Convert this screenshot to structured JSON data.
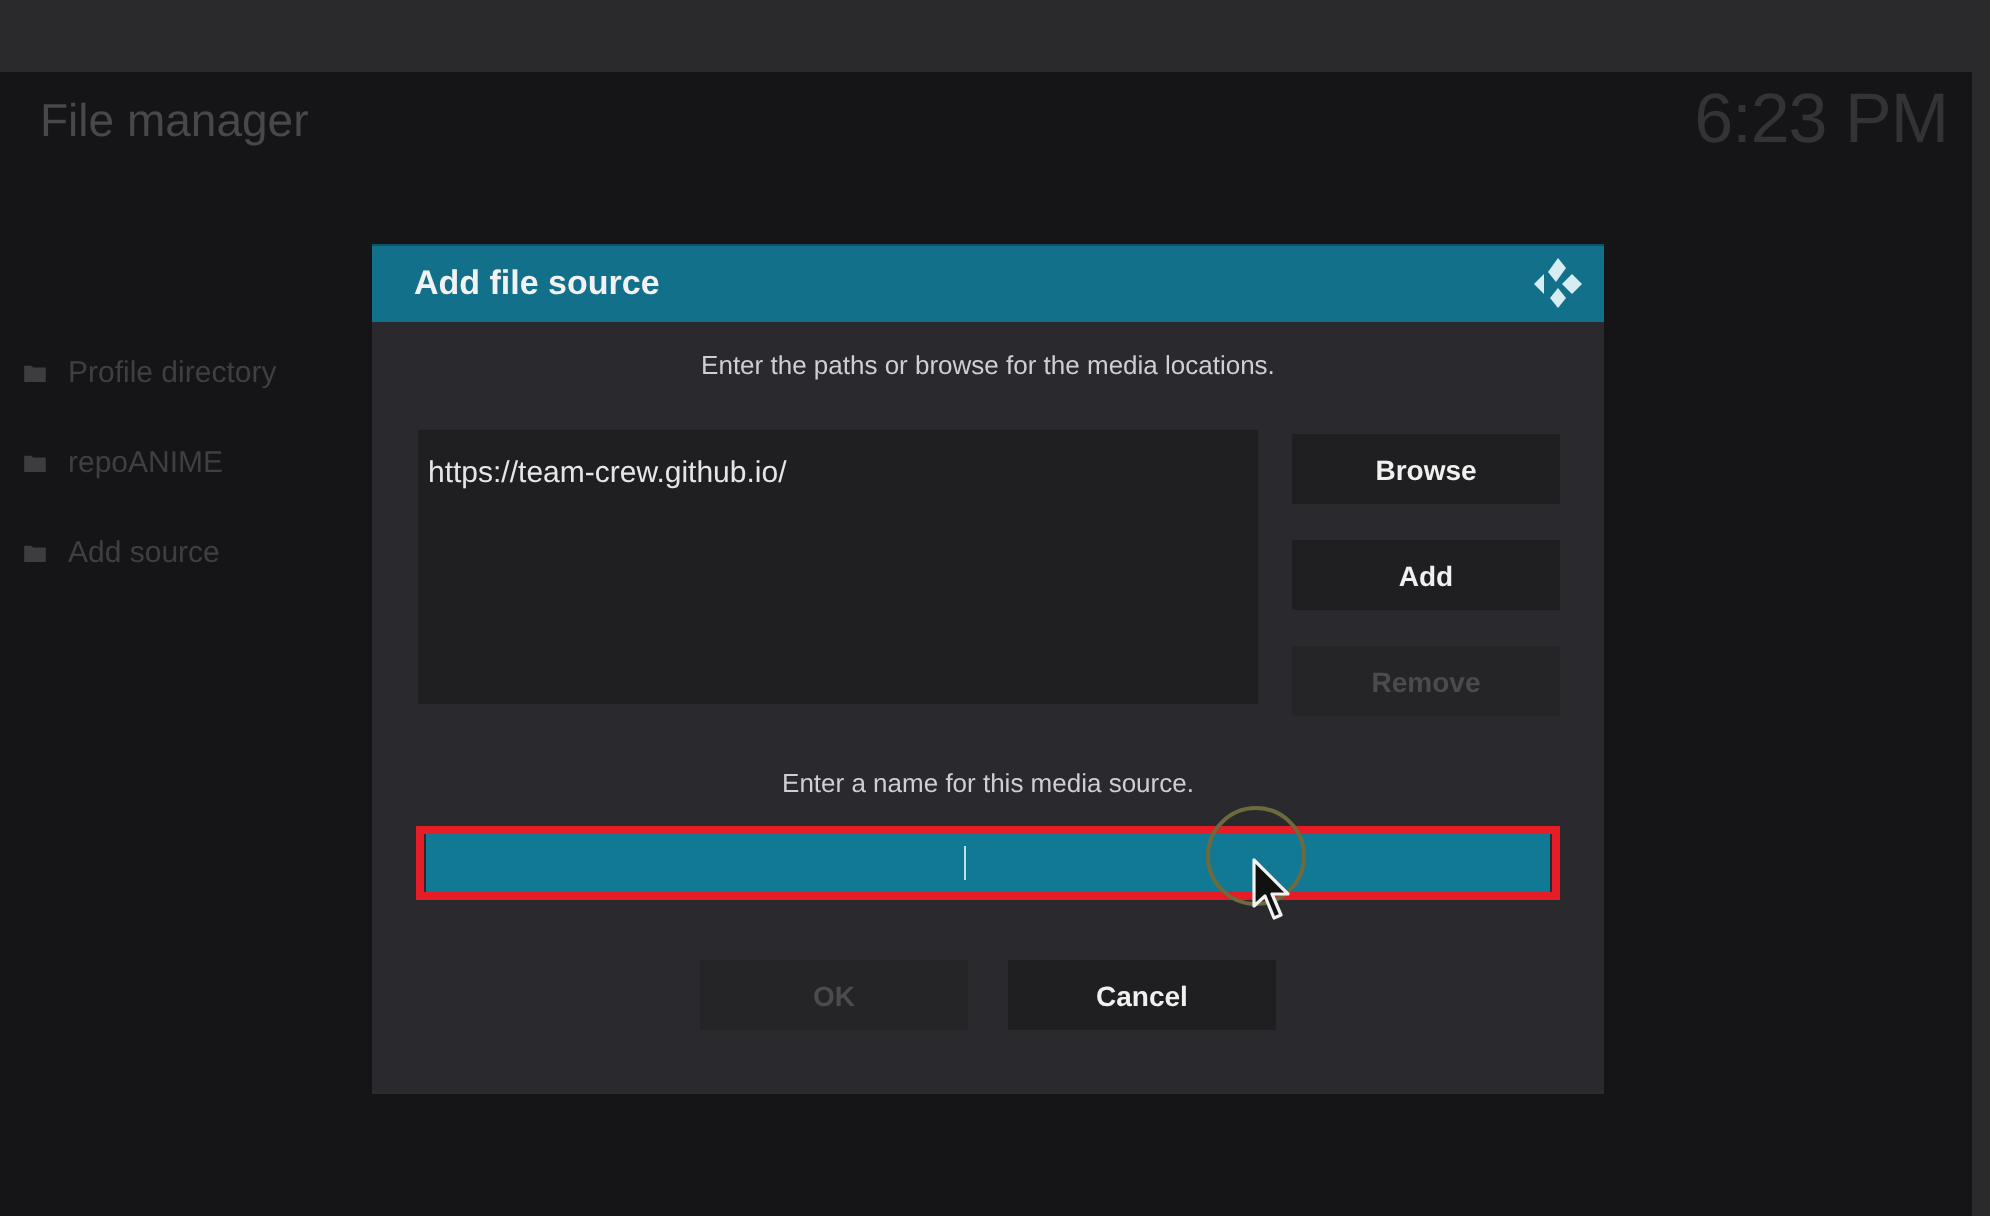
{
  "header": {
    "title": "File manager",
    "clock": "6:23 PM"
  },
  "sidebar": {
    "items": [
      {
        "label": "Profile directory"
      },
      {
        "label": "repoANIME"
      },
      {
        "label": "Add source"
      }
    ]
  },
  "dialog": {
    "title": "Add file source",
    "paths_prompt": "Enter the paths or browse for the media locations.",
    "paths": [
      "https://team-crew.github.io/"
    ],
    "side_buttons": [
      {
        "label": "Browse",
        "disabled": false
      },
      {
        "label": "Add",
        "disabled": false
      },
      {
        "label": "Remove",
        "disabled": true
      }
    ],
    "name_prompt": "Enter a name for this media source.",
    "name_field": {
      "focused": true,
      "highlighted": true
    },
    "buttons": [
      {
        "label": "OK",
        "disabled": true
      },
      {
        "label": "Cancel",
        "disabled": false
      }
    ]
  }
}
